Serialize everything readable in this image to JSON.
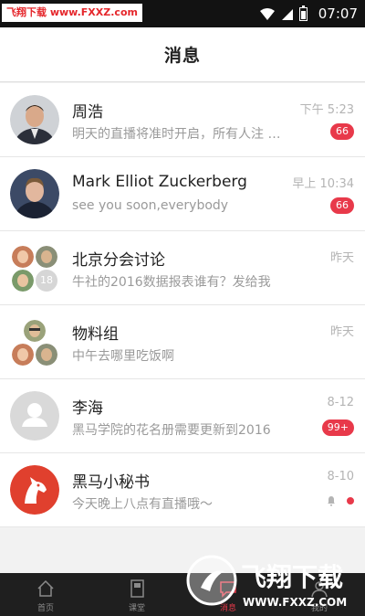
{
  "status_bar": {
    "site_badge": "飞翔下载 www.FXXZ.com",
    "time": "07:07",
    "icons": [
      "wifi-icon",
      "signal-icon",
      "battery-icon"
    ]
  },
  "nav": {
    "title": "消息"
  },
  "messages": [
    {
      "name": "周浩",
      "preview": "明天的直播将准时开启，所有人注 …",
      "time": "下午 5:23",
      "badge": "66",
      "avatar": "person-photo"
    },
    {
      "name": "Mark Elliot Zuckerberg",
      "preview": "see you soon,everybody",
      "time": "早上 10:34",
      "badge": "66",
      "avatar": "person-photo"
    },
    {
      "name": "北京分会讨论",
      "preview": "牛社的2016数据报表谁有？发给我",
      "time": "昨天",
      "group_count": "18",
      "avatar": "group-avatars"
    },
    {
      "name": "物料组",
      "preview": "中午去哪里吃饭啊",
      "time": "昨天",
      "avatar": "group-avatars"
    },
    {
      "name": "李海",
      "preview": "黑马学院的花名册需要更新到2016",
      "time": "8-12",
      "badge": "99+",
      "avatar": "default-person-icon"
    },
    {
      "name": "黑马小秘书",
      "preview": "今天晚上八点有直播哦～",
      "time": "8-10",
      "avatar": "horse-logo",
      "muted": true
    }
  ],
  "tabs": [
    {
      "label": "首页",
      "icon": "home-icon"
    },
    {
      "label": "课堂",
      "icon": "book-icon"
    },
    {
      "label": "消息",
      "icon": "message-icon",
      "active": true
    },
    {
      "label": "我的",
      "icon": "profile-icon"
    }
  ],
  "watermark": {
    "text": "飞翔下载",
    "url": "WWW.FXXZ.COM"
  },
  "colors": {
    "accent": "#e8394a",
    "tab_bar": "#1f1f1f",
    "status_bar": "#121212"
  }
}
